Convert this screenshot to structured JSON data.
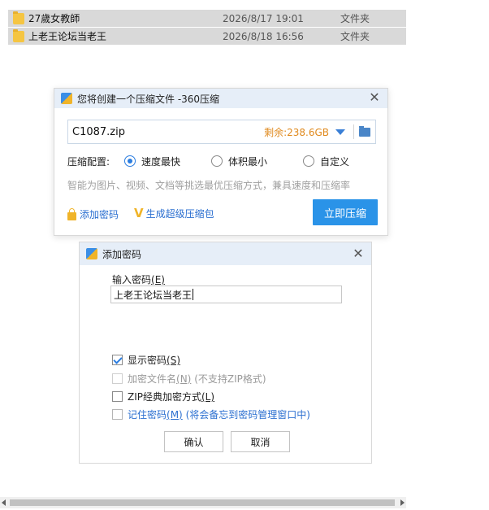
{
  "files": [
    {
      "name": "27歲女教師",
      "date": "2026/8/17 19:01",
      "type": "文件夹"
    },
    {
      "name": "上老王论坛当老王",
      "date": "2026/8/18 16:56",
      "type": "文件夹"
    }
  ],
  "compress_dialog": {
    "title": "您将创建一个压缩文件 -360压缩",
    "filename": "C1087.zip",
    "free_space": "剩余:238.6GB",
    "config_label": "压缩配置:",
    "options": [
      "速度最快",
      "体积最小",
      "自定义"
    ],
    "selected_option": "速度最快",
    "hint": "智能为图片、视频、文档等挑选最优压缩方式，兼具速度和压缩率",
    "add_password": "添加密码",
    "super_pack": "生成超级压缩包",
    "compress_button": "立即压缩"
  },
  "password_dialog": {
    "title": "添加密码",
    "input_label": "输入密码",
    "input_label_key": "(E)",
    "password_value": "上老王论坛当老王",
    "show_password": {
      "label": "显示密码",
      "key": "(S)",
      "checked": true
    },
    "encrypt_filename": {
      "label": "加密文件名",
      "key": "(N)",
      "note": "(不支持ZIP格式)",
      "checked": false,
      "disabled": true
    },
    "zip_classic": {
      "label": "ZIP经典加密方式",
      "key": "(L)",
      "checked": false
    },
    "remember_password": {
      "label": "记住密码",
      "key": "(M)",
      "note": "(将会备忘到密码管理窗口中)",
      "checked": false
    },
    "ok_button": "确认",
    "cancel_button": "取消"
  },
  "colors": {
    "accent": "#2a93e8",
    "title_bar": "#e6eef8",
    "free_space": "#e08a1e",
    "link": "#2b6fd0"
  }
}
